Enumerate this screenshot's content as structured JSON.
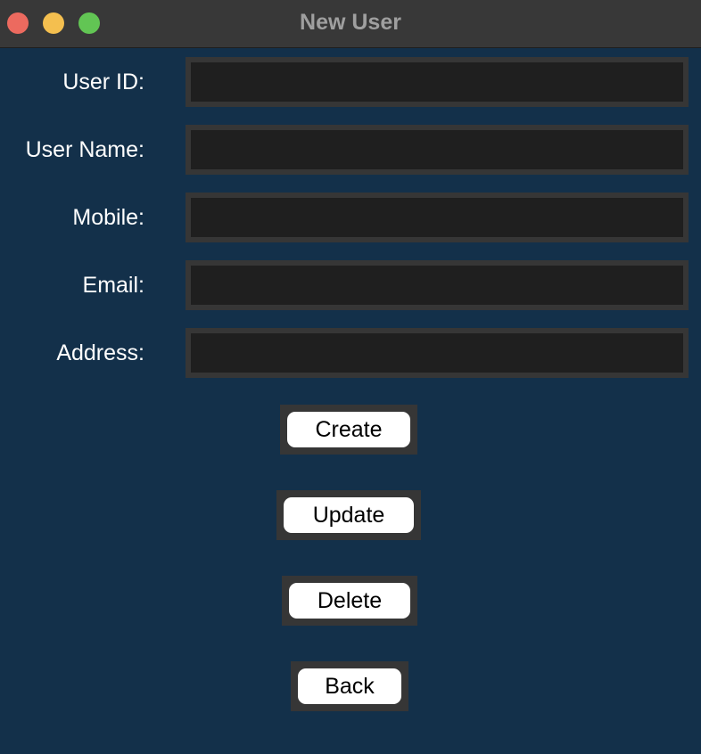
{
  "window": {
    "title": "New User",
    "traffic_lights": {
      "close_color": "#ec6a5f",
      "minimize_color": "#f4bf4f",
      "zoom_color": "#62c554"
    }
  },
  "form": {
    "fields": [
      {
        "label": "User ID:",
        "value": "",
        "placeholder": ""
      },
      {
        "label": "User Name:",
        "value": "",
        "placeholder": ""
      },
      {
        "label": "Mobile:",
        "value": "",
        "placeholder": ""
      },
      {
        "label": "Email:",
        "value": "",
        "placeholder": ""
      },
      {
        "label": "Address:",
        "value": "",
        "placeholder": ""
      }
    ]
  },
  "buttons": {
    "create": "Create",
    "update": "Update",
    "delete": "Delete",
    "back": "Back"
  },
  "colors": {
    "background": "#13304a",
    "input_bg": "#1f1f1f",
    "input_border": "#363636",
    "button_bg": "#ffffff"
  }
}
